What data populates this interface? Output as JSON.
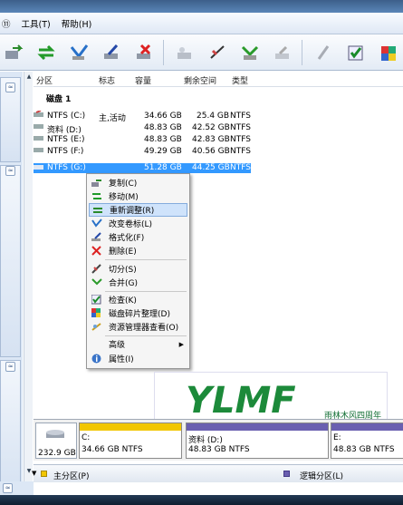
{
  "menu": [
    "⑪",
    "工具(T)",
    "帮助(H)"
  ],
  "columns": {
    "partition": "分区",
    "flag": "标志",
    "capacity": "容量",
    "free": "剩余空间",
    "type": "类型"
  },
  "disk_label": "磁盘 1",
  "partitions": [
    {
      "name": "NTFS (C:)",
      "flag": "主,活动",
      "capacity": "34.66 GB",
      "free": "25.4 GB",
      "type": "NTFS",
      "selected": false
    },
    {
      "name": "资料 (D:)",
      "flag": "",
      "capacity": "48.83 GB",
      "free": "42.52 GB",
      "type": "NTFS",
      "selected": false
    },
    {
      "name": "NTFS (E:)",
      "flag": "",
      "capacity": "48.83 GB",
      "free": "42.83 GB",
      "type": "NTFS",
      "selected": false
    },
    {
      "name": "NTFS (F:)",
      "flag": "",
      "capacity": "49.29 GB",
      "free": "40.56 GB",
      "type": "NTFS",
      "selected": false
    },
    {
      "name": "NTFS (G:)",
      "flag": "",
      "capacity": "51.28 GB",
      "free": "44.25 GB",
      "type": "NTFS",
      "selected": true
    }
  ],
  "context_menu": [
    {
      "label": "复制(C)",
      "icon": "copy-icon"
    },
    {
      "label": "移动(M)",
      "icon": "move-icon"
    },
    {
      "label": "重新调整(R)",
      "icon": "resize-icon",
      "highlighted": true
    },
    {
      "label": "改变卷标(L)",
      "icon": "label-icon"
    },
    {
      "label": "格式化(F)",
      "icon": "format-icon"
    },
    {
      "label": "删除(E)",
      "icon": "delete-icon"
    },
    {
      "label": "切分(S)",
      "icon": "split-icon"
    },
    {
      "label": "合并(G)",
      "icon": "merge-icon"
    },
    {
      "label": "检查(K)",
      "icon": "check-icon"
    },
    {
      "label": "磁盘碎片整理(D)",
      "icon": "defrag-icon"
    },
    {
      "label": "资源管理器查看(O)",
      "icon": "explorer-icon"
    },
    {
      "label": "高级",
      "icon": "",
      "submenu": true
    },
    {
      "label": "属性(I)",
      "icon": "info-icon"
    }
  ],
  "banner": {
    "logo": "YLMF",
    "text": "雨林木风四周年"
  },
  "diskmap": {
    "disk_size": "232.9 GB",
    "c_label": "C:",
    "c_size": "34.66 GB  NTFS",
    "d_label": "资料 (D:)",
    "d_size": "48.83 GB  NTFS",
    "e_label": "E:",
    "e_size": "48.83 GB  NTFS"
  },
  "legend": {
    "primary": "主分区(P)",
    "logical": "逻辑分区(L)"
  },
  "colors": {
    "selection": "#3399ff",
    "primary_bar": "#f2c600",
    "logical_bar": "#6a5fb0"
  }
}
